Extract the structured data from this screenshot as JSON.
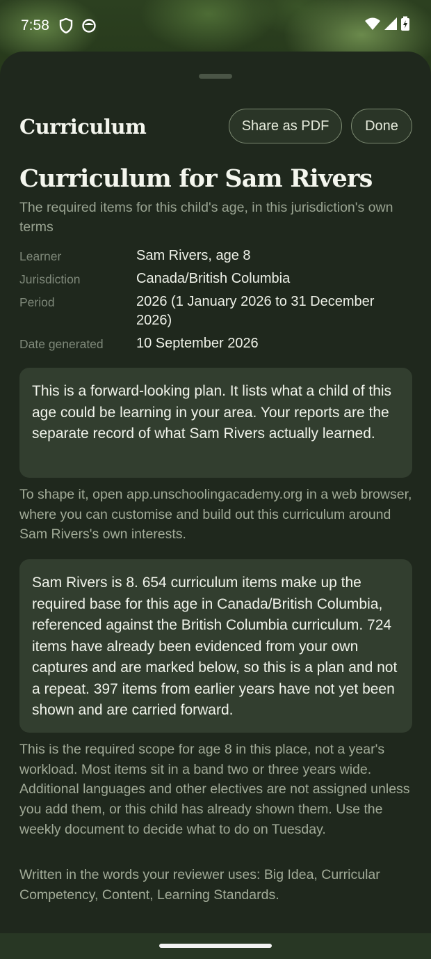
{
  "status_bar": {
    "time": "7:58",
    "icons": [
      "shield-icon",
      "face-icon",
      "wifi-icon",
      "signal-icon",
      "battery-charging-icon"
    ]
  },
  "header": {
    "title": "Curriculum",
    "share_label": "Share as PDF",
    "done_label": "Done"
  },
  "page": {
    "title": "Curriculum for Sam Rivers",
    "subtitle": "The required items for this child's age, in this jurisdiction's own terms"
  },
  "meta": [
    {
      "label": "Learner",
      "value": "Sam Rivers, age 8"
    },
    {
      "label": "Jurisdiction",
      "value": "Canada/British Columbia"
    },
    {
      "label": "Period",
      "value": "2026 (1 January 2026 to 31 December 2026)"
    },
    {
      "label": "Date generated",
      "value": "10 September 2026"
    }
  ],
  "notice_card": "This is a forward-looking plan. It lists what a child of this age could be learning in your area. Your reports are the separate record of what Sam Rivers actually learned.",
  "shape_text": "To shape it, open app.unschoolingacademy.org in a web browser, where you can customise and build out this curriculum around Sam Rivers's own interests.",
  "summary_card": "Sam Rivers is 8. 654 curriculum items make up the required base for this age in Canada/British Columbia, referenced against the British Columbia curriculum. 724 items have already been evidenced from your own captures and are marked below, so this is a plan and not a repeat. 397 items from earlier years have not yet been shown and are carried forward.",
  "scope_text": "This is the required scope for age 8 in this place, not a year's workload. Most items sit in a band two or three years wide. Additional languages and other electives are not assigned unless you add them, or this child has already shown them. Use the weekly document to decide what to do on Tuesday.",
  "terms_text": "Written in the words your reviewer uses: Big Idea, Curricular Competency, Content, Learning Standards."
}
